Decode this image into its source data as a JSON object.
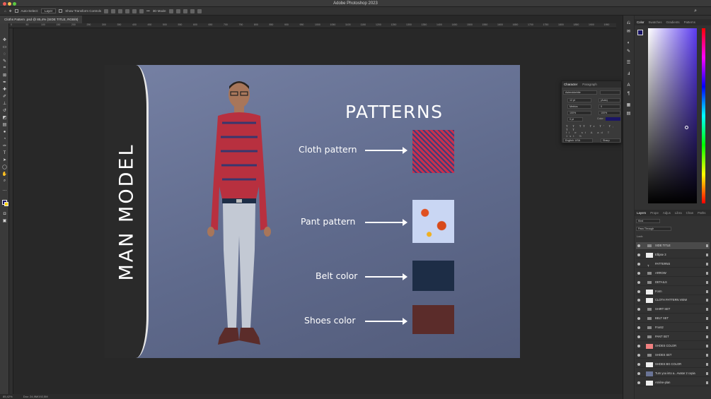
{
  "window": {
    "title": "Adobe Photoshop 2023"
  },
  "options_bar": {
    "auto_select_label": "Auto-Select:",
    "auto_select_value": "Layer",
    "show_transform_label": "Show Transform Controls",
    "mode_3d_label": "3D Mode:"
  },
  "document_tab": {
    "label": "Cloths Pattern .psd @ 85,4% (SIDE TITLE, RGB/8)"
  },
  "ruler_numbers": [
    "0",
    "50",
    "100",
    "150",
    "200",
    "250",
    "300",
    "350",
    "400",
    "450",
    "500",
    "550",
    "600",
    "650",
    "700",
    "750",
    "800",
    "850",
    "900",
    "950",
    "1000",
    "1050",
    "1100",
    "1150",
    "1200",
    "1250",
    "1300",
    "1350",
    "1400",
    "1450",
    "1500",
    "1550",
    "1600",
    "1650",
    "1700",
    "1750",
    "1800",
    "1850",
    "1900",
    "1950"
  ],
  "status_bar": {
    "zoom": "85,42%",
    "doc": "Doc: 24,9M/192,5M"
  },
  "artboard": {
    "side_title": "MAN MODEL",
    "patterns_title": "PATTERNS",
    "labels": {
      "cloth": "Cloth pattern",
      "pant": "Pant pattern",
      "belt": "Belt color",
      "shoes": "Shoes color"
    },
    "colors": {
      "belt": "#1d2d46",
      "shoes": "#5b2c2a",
      "background": "#6a7496",
      "band": "#2a2a2a"
    }
  },
  "character_panel": {
    "tabs": [
      "Character",
      "Paragraph"
    ],
    "font_family": "Asteroidwhite",
    "font_size": "12 pt",
    "leading": "(Auto)",
    "kerning": "Metrics",
    "tracking": "0",
    "vert_scale": "100%",
    "horiz_scale": "100%",
    "baseline": "0 pt",
    "color_label": "Color:",
    "language": "English: USA",
    "antialias": "Sharp"
  },
  "right_panels": {
    "color_tabs": [
      "Color",
      "Swatches",
      "Gradients",
      "Patterns"
    ],
    "layer_tabs": [
      "Layers",
      "Prope",
      "Adjus",
      "Libra",
      "Chan",
      "Paths"
    ],
    "layer_filter": "Kind",
    "layer_mode": "Pass Through",
    "lock_label": "Lock:",
    "layers": [
      {
        "name": "SIDE TITLE",
        "kind": "folder",
        "selected": true
      },
      {
        "name": "Ellipse 3",
        "kind": "shape"
      },
      {
        "name": "PATTERNS",
        "kind": "text"
      },
      {
        "name": "ARROW",
        "kind": "folder"
      },
      {
        "name": "DETAILS",
        "kind": "folder"
      },
      {
        "name": "Form",
        "kind": "shape"
      },
      {
        "name": "CLOTH PATTERN VIEW",
        "kind": "shape"
      },
      {
        "name": "SHIRT SET",
        "kind": "folder"
      },
      {
        "name": "BELT SET",
        "kind": "folder"
      },
      {
        "name": "Front2",
        "kind": "folder"
      },
      {
        "name": "PANT SET",
        "kind": "folder"
      },
      {
        "name": "SHOES COLOR",
        "kind": "masked"
      },
      {
        "name": "SHOES SET",
        "kind": "folder"
      },
      {
        "name": "SHOES BG COLOR",
        "kind": "shape"
      },
      {
        "name": "Turn you into a...Avatar 2 copia",
        "kind": "image"
      },
      {
        "name": "Arrière-plan",
        "kind": "image"
      }
    ]
  }
}
